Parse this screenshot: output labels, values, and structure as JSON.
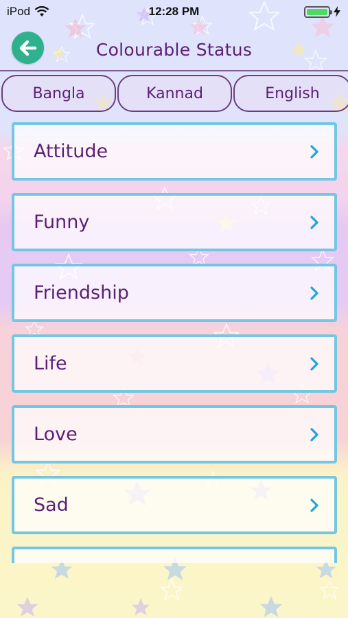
{
  "status_bar": {
    "carrier": "iPod",
    "time": "12:28 PM",
    "wifi_icon": "wifi-icon",
    "battery_icon": "battery-icon",
    "charging_icon": "charging-bolt-icon"
  },
  "header": {
    "title": "Colourable Status",
    "back_icon": "back-arrow-icon"
  },
  "tabs": [
    {
      "label": "Bangla"
    },
    {
      "label": "Kannad"
    },
    {
      "label": "English"
    }
  ],
  "categories": [
    {
      "label": "Attitude"
    },
    {
      "label": "Funny"
    },
    {
      "label": "Friendship"
    },
    {
      "label": "Life"
    },
    {
      "label": "Love"
    },
    {
      "label": "Sad"
    },
    {
      "label": ""
    }
  ],
  "colors": {
    "title": "#5b1f74",
    "back_button": "#2fb18e",
    "item_border": "#74c6e3",
    "chevron": "#1fa6d8"
  }
}
